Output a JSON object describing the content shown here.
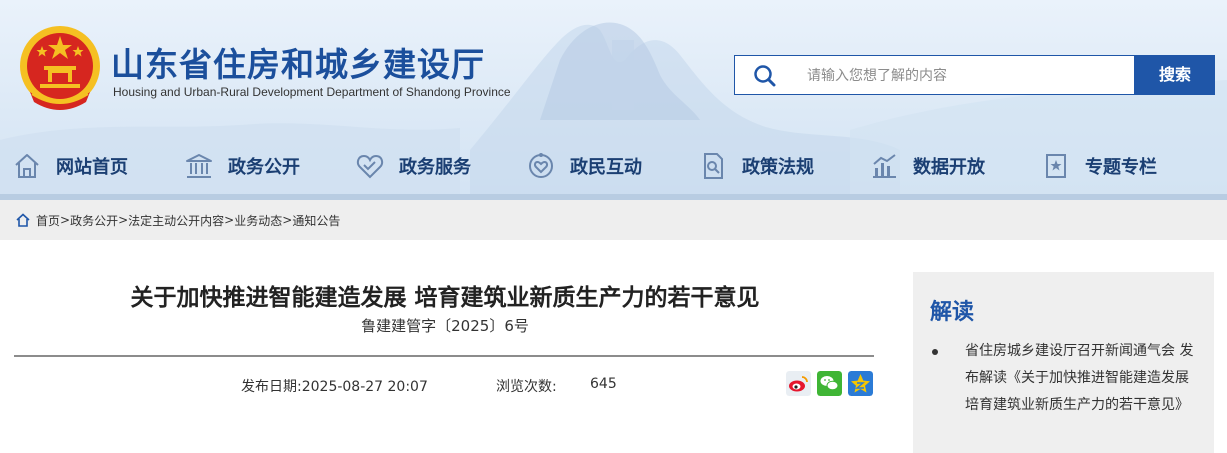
{
  "header": {
    "title": "山东省住房和城乡建设厅",
    "subtitle": "Housing and Urban-Rural Development Department of Shandong Province"
  },
  "search": {
    "placeholder": "请输入您想了解的内容",
    "button_label": "搜索"
  },
  "nav": {
    "items": [
      {
        "label": "网站首页",
        "icon": "home-icon"
      },
      {
        "label": "政务公开",
        "icon": "building-icon"
      },
      {
        "label": "政务服务",
        "icon": "handshake-heart-icon"
      },
      {
        "label": "政民互动",
        "icon": "people-heart-icon"
      },
      {
        "label": "政策法规",
        "icon": "document-icon"
      },
      {
        "label": "数据开放",
        "icon": "chart-icon"
      },
      {
        "label": "专题专栏",
        "icon": "topic-icon"
      }
    ]
  },
  "breadcrumb": {
    "icon": "home-icon",
    "items": [
      "首页",
      "政务公开",
      "法定主动公开内容",
      "业务动态",
      "通知公告"
    ],
    "separator": ">"
  },
  "article": {
    "title": "关于加快推进智能建造发展 培育建筑业新质生产力的若干意见",
    "doc_number": "鲁建建管字〔2025〕6号",
    "date_label": "发布日期:2025-08-27 20:07",
    "views_label": "浏览次数:",
    "views_value": "645",
    "share_icons": [
      "weibo-icon",
      "wechat-icon",
      "qzone-icon"
    ]
  },
  "sidebar": {
    "title": "解读",
    "items": [
      "省住房城乡建设厅召开新闻通气会 发布解读《关于加快推进智能建造发展 培育建筑业新质生产力的若干意见》"
    ]
  },
  "colors": {
    "brand_blue": "#1f56a8",
    "nav_text": "#1b3f73",
    "breadcrumb_bg": "#eeeeee",
    "sidebar_bg": "#efefef"
  }
}
